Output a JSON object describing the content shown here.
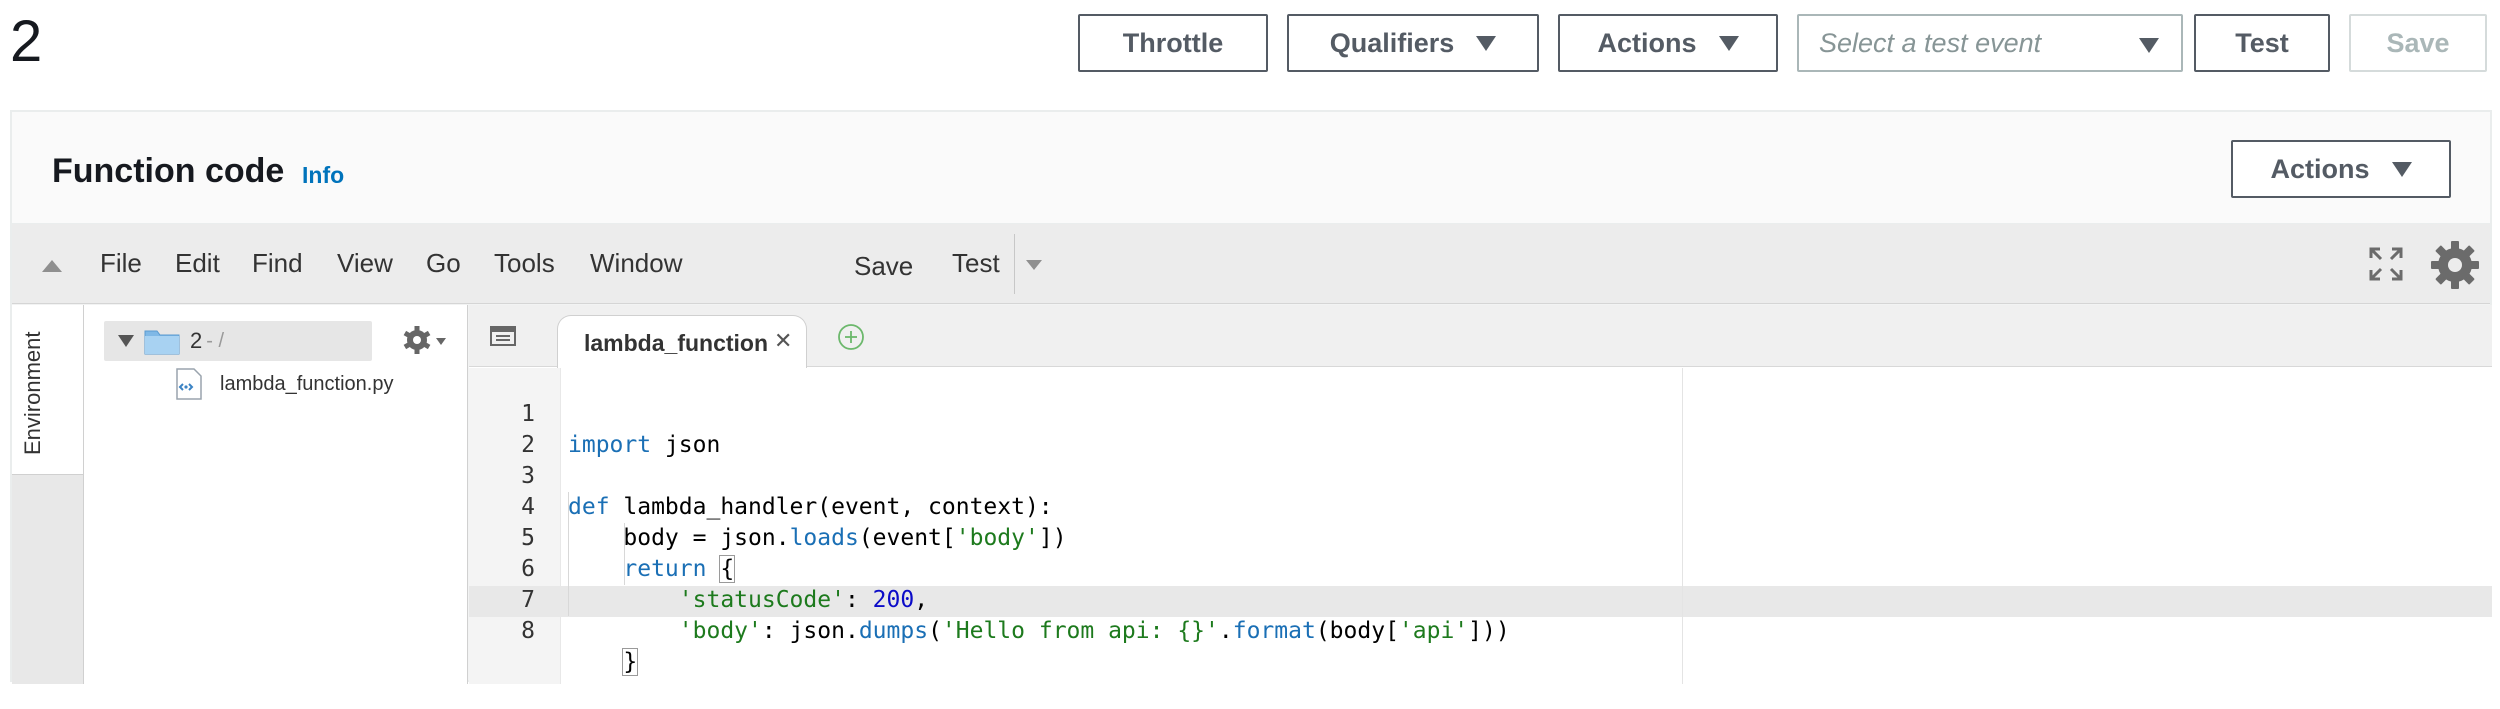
{
  "page": {
    "title": "2"
  },
  "toolbar": {
    "throttle": "Throttle",
    "qualifiers": "Qualifiers",
    "actions": "Actions",
    "test_event_placeholder": "Select a test event",
    "test": "Test",
    "save": "Save"
  },
  "panel": {
    "title": "Function code",
    "info": "Info",
    "actions": "Actions"
  },
  "ide_menu": {
    "items": [
      "File",
      "Edit",
      "Find",
      "View",
      "Go",
      "Tools",
      "Window"
    ],
    "save": "Save",
    "test": "Test"
  },
  "environment": {
    "label": "Environment"
  },
  "tree": {
    "root_label": "2",
    "root_suffix": "- /",
    "file": "lambda_function.py"
  },
  "editor": {
    "tab_label": "lambda_function",
    "lines": [
      "import json",
      "",
      "def lambda_handler(event, context):",
      "    body = json.loads(event['body'])",
      "    return {",
      "        'statusCode': 200,",
      "        'body': json.dumps('Hello from api: {}'.format(body['api']))",
      "    }"
    ],
    "line_numbers": [
      "1",
      "2",
      "3",
      "4",
      "5",
      "6",
      "7",
      "8"
    ],
    "active_line": 8
  },
  "colors": {
    "keyword": "#1a6fb5",
    "string": "#1d7a1d",
    "number": "#0b0bc8",
    "link": "#0073bb"
  },
  "icons": {
    "fullscreen": "fullscreen-icon",
    "settings": "gear-icon",
    "folder": "folder-icon",
    "python_file": "file-icon",
    "add_tab": "add-tab-icon",
    "tab_close": "close-icon"
  }
}
